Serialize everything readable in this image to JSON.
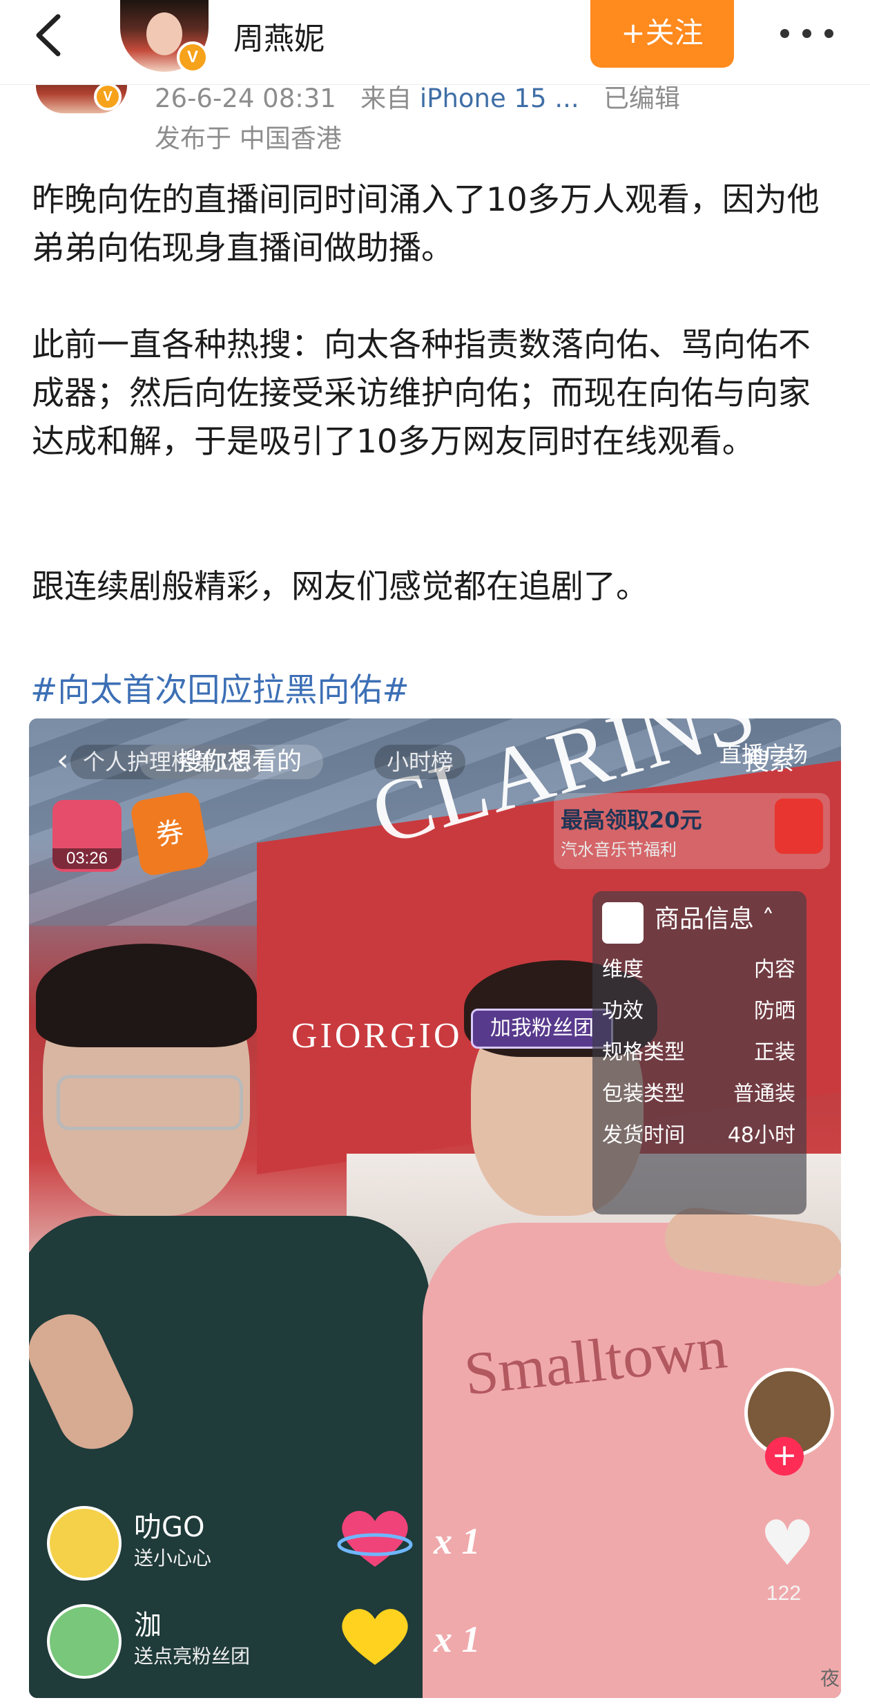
{
  "header": {
    "nickname": "周燕妮",
    "follow_label": "+关注",
    "verified_badge": "V"
  },
  "post": {
    "meta_date": "26-6-24 08:31",
    "meta_from": "来自",
    "meta_source": "iPhone 15 ...",
    "meta_edited": "已编辑",
    "meta_location": "发布于 中国香港",
    "paragraphs": [
      "昨晚向佐的直播间同时间涌入了10多万人观看，因为他弟弟向佑现身直播间做助播。",
      "此前一直各种热搜：向太各种指责数落向佑、骂向佑不成器；然后向佐接受采访维护向佑；而现在向佑与向家达成和解，于是吸引了10多万网友同时在线观看。",
      "跟连续剧般精彩，网友们感觉都在追剧了。"
    ],
    "hashtag": "#向太首次回应拉黑向佑#"
  },
  "live": {
    "chip_category": "个人护理榜第1名",
    "search_placeholder": "搜你想看的",
    "chip_hour": "小时榜",
    "live_square": "直播广场",
    "search_button": "搜索",
    "giftbag_timer": "03:26",
    "coupon_label": "券",
    "promo_title": "最高领取20元",
    "promo_sub": "汽水音乐节福利",
    "brand_sign": "CLARINS",
    "brand_sign2": "GIORGIO",
    "fan_chip": "加我粉丝团",
    "shirt_print": "Smalltown",
    "product": {
      "title": "商品信息",
      "rows": [
        {
          "k": "维度",
          "v": "内容"
        },
        {
          "k": "功效",
          "v": "防晒"
        },
        {
          "k": "规格类型",
          "v": "正装"
        },
        {
          "k": "包装类型",
          "v": "普通装"
        },
        {
          "k": "发货时间",
          "v": "48小时"
        }
      ]
    },
    "likes_count": "122",
    "gifts": [
      {
        "name": "叻GO",
        "desc": "送小心心",
        "count": "x 1"
      },
      {
        "name": "泇",
        "desc": "送点亮粉丝团",
        "count": "x 1"
      }
    ]
  },
  "watermark": "夜"
}
